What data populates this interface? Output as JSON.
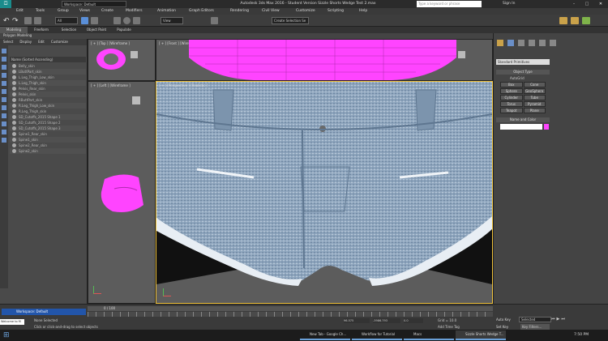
{
  "title": {
    "text": "Autodesk 3ds Max 2016 - Student Version    Sizzle Shorts Wedge Test 2.max",
    "workspace": "Workspace: Default",
    "search_placeholder": "Type a keyword or phrase",
    "sign_in": "Sign In"
  },
  "menu": [
    "Edit",
    "Tools",
    "Group",
    "Views",
    "Create",
    "Modifiers",
    "Animation",
    "Graph Editors",
    "Rendering",
    "Civil View",
    "Customize",
    "Scripting",
    "Help"
  ],
  "toolbar": {
    "selection_filter": "All",
    "view": "View",
    "named_selection": "Create Selection Se"
  },
  "ribbon_tabs": [
    "Modeling",
    "Freeform",
    "Selection",
    "Object Paint",
    "Populate"
  ],
  "ribbon_sub": "Polygon Modeling",
  "scene_explorer": {
    "tabs": [
      "Select",
      "Display",
      "Edit",
      "Customize"
    ],
    "header": "Name (Sorted Ascending)",
    "items": [
      "Belly_skin",
      "LButtPart_skin",
      "L.Leg_Thigh_Low_skin",
      "L.Leg_Thigh_skin",
      "Pelvis_Rear_skin",
      "Pelvis_skin",
      "RButtPart_skin",
      "R.Leg_Thigh_Low_skin",
      "R.Leg_Thigh_skin",
      "SD_Cutoffs_2015 Shape 1",
      "SD_Cutoffs_2015 Shape 2",
      "SD_Cutoffs_2015 Shape 3",
      "Spine1_Rear_skin",
      "Spine1_skin",
      "Spine2_Rear_skin",
      "Spine2_skin"
    ]
  },
  "viewports": {
    "top": "[ + ] [Top ] [Wireframe ]",
    "front": "[ + ] [Front ] [Wireframe ]",
    "left": "[ + ] [Left ] [Wireframe ]",
    "persp": "[ + ] [Perspective ] [Realistic ]"
  },
  "command_panel": {
    "dropdown": "Standard Primitives",
    "object_type": "Object Type",
    "autogrid": "AutoGrid",
    "buttons": [
      "Box",
      "Cone",
      "Sphere",
      "GeoSphere",
      "Cylinder",
      "Tube",
      "Torus",
      "Pyramid",
      "Teapot",
      "Plane"
    ],
    "name_and_color": "Name and Color"
  },
  "status": {
    "timeline": "0 / 100",
    "workspace": "Workspace: Default",
    "selected": "None Selected",
    "hint": "Click or click-and-drag to select objects",
    "x": "96.575",
    "y": "-3986.793",
    "z": "0.0",
    "grid": "Grid = 10.0",
    "add_time_tag": "Add Time Tag",
    "auto_key": "Auto Key",
    "set_key": "Set Key",
    "selected_dd": "Selected",
    "key_filters": "Key Filters...",
    "maxscript": "Welcome to M"
  },
  "taskbar": {
    "apps": [
      "New Tab - Google Ch...",
      "Workflow for Tutorial",
      "Macs",
      "Sizzle Shorts Wedge T..."
    ],
    "time": "7:50 PM"
  },
  "colors": {
    "accent": "#ff44ff",
    "denim": "#8fa6be",
    "window_dark": "#2b2b2b"
  }
}
